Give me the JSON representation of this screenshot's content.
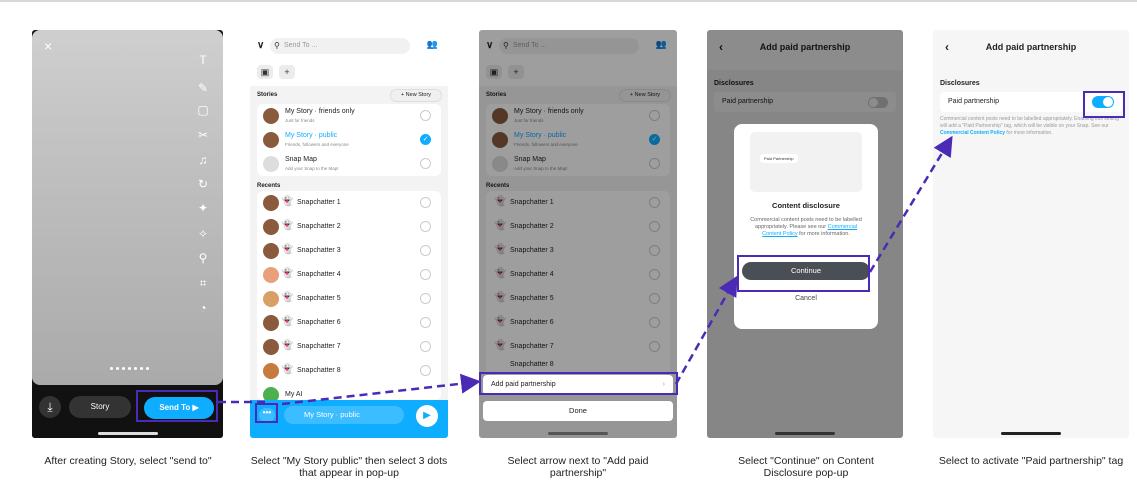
{
  "accent": "#4b2bb5",
  "snap_blue": "#0fadff",
  "screen1": {
    "close": "×",
    "tools": [
      "T",
      "✎",
      "▢",
      "✂",
      "♫",
      "↻",
      "✦",
      "✧",
      "⚲",
      "⌗",
      "◔"
    ],
    "download": "⤓",
    "story_label": "Story",
    "send_to_label": "Send To ▶"
  },
  "screen2": {
    "search_placeholder": "Send To ...",
    "stories_heading": "Stories",
    "new_story": "+ New Story",
    "stories": [
      {
        "title": "My Story · friends only",
        "subtitle": "Just for friends",
        "checked": false
      },
      {
        "title": "My Story · public",
        "subtitle": "Friends, followers and everyone",
        "checked": true
      },
      {
        "title": "Snap Map",
        "subtitle": "Add your Snap to the Map!",
        "checked": false
      }
    ],
    "recents_heading": "Recents",
    "recents": [
      "Snapchatter 1",
      "Snapchatter 2",
      "Snapchatter 3",
      "Snapchatter 4",
      "Snapchatter 5",
      "Snapchatter 6",
      "Snapchatter 7",
      "Snapchatter 8"
    ],
    "my_ai": "My AI",
    "more": "•••",
    "bottom_pill": "My Story · public"
  },
  "screen3": {
    "search_placeholder": "Send To ...",
    "stories_heading": "Stories",
    "new_story": "+ New Story",
    "stories": [
      {
        "title": "My Story · friends only",
        "subtitle": "Just for friends"
      },
      {
        "title": "My Story · public",
        "subtitle": "Friends, followers and everyone"
      },
      {
        "title": "Snap Map",
        "subtitle": "Add your Snap to the Map!"
      }
    ],
    "recents_heading": "Recents",
    "recents": [
      "Snapchatter 1",
      "Snapchatter 2",
      "Snapchatter 3",
      "Snapchatter 4",
      "Snapchatter 5",
      "Snapchatter 6",
      "Snapchatter 7",
      "Snapchatter 8"
    ],
    "sheet_item": "Add paid partnership",
    "done": "Done"
  },
  "screen4": {
    "back": "‹",
    "title": "Add paid partnership",
    "disclosures": "Disclosures",
    "paid_partnership": "Paid partnership",
    "preview_label": "Paid Partnership",
    "modal_title": "Content disclosure",
    "modal_body_1": "Commercial content posts need to be labelled appropriately. Please see our",
    "modal_link": "Commercial Content Policy",
    "modal_body_2": "for more information.",
    "continue": "Continue",
    "cancel": "Cancel"
  },
  "screen5": {
    "back": "‹",
    "title": "Add paid partnership",
    "disclosures": "Disclosures",
    "paid_partnership": "Paid partnership",
    "desc_1": "Commercial content posts need to be labelled appropriately. Enabling this setting will add a \"Paid Partnership\" tag, which will be visible on your Snap. See our",
    "desc_link": "Commercial Content Policy",
    "desc_2": "for more information."
  },
  "captions": [
    "After creating Story, select \"send to\"",
    "Select \"My Story public\" then select 3 dots that appear in pop-up",
    "Select arrow next to \"Add paid partnership\"",
    "Select \"Continue\" on Content Disclosure pop-up",
    "Select to activate \"Paid partnership\" tag"
  ]
}
